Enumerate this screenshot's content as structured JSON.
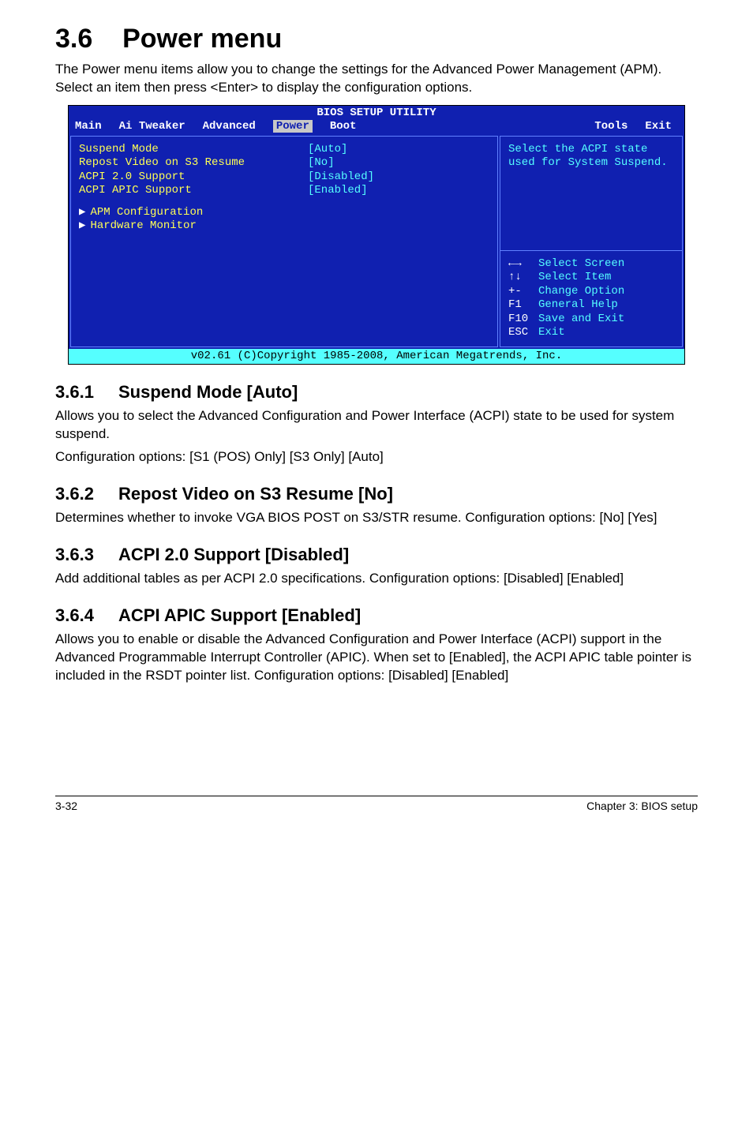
{
  "title": {
    "num": "3.6",
    "text": "Power menu"
  },
  "intro": "The Power menu items allow you to change the settings for the Advanced Power Management (APM). Select an item then press <Enter> to display the configuration options.",
  "bios": {
    "header": "BIOS SETUP UTILITY",
    "menus": [
      "Main",
      "Ai Tweaker",
      "Advanced",
      "Power",
      "Boot",
      "Tools",
      "Exit"
    ],
    "activeMenu": "Power",
    "rows": [
      {
        "label": "Suspend Mode",
        "value": "[Auto]"
      },
      {
        "label": "Repost Video on S3 Resume",
        "value": "[No]"
      },
      {
        "label": "ACPI 2.0 Support",
        "value": "[Disabled]"
      },
      {
        "label": "ACPI APIC Support",
        "value": "[Enabled]"
      }
    ],
    "submenus": [
      "APM Configuration",
      "Hardware Monitor"
    ],
    "help": "Select the ACPI state used for System Suspend.",
    "keys": [
      {
        "k": "←→",
        "d": "Select Screen"
      },
      {
        "k": "↑↓",
        "d": "Select Item"
      },
      {
        "k": "+-",
        "d": "Change Option"
      },
      {
        "k": "F1",
        "d": "General Help"
      },
      {
        "k": "F10",
        "d": "Save and Exit"
      },
      {
        "k": "ESC",
        "d": "Exit"
      }
    ],
    "footer": "v02.61 (C)Copyright 1985-2008, American Megatrends, Inc."
  },
  "sections": [
    {
      "num": "3.6.1",
      "title": "Suspend Mode [Auto]",
      "body": [
        "Allows you to select the Advanced Configuration and Power Interface (ACPI) state to be used for system suspend.",
        "Configuration options: [S1 (POS) Only] [S3 Only] [Auto]"
      ]
    },
    {
      "num": "3.6.2",
      "title": "Repost Video on S3 Resume [No]",
      "body": [
        "Determines whether to invoke VGA BIOS POST on S3/STR resume. Configuration options: [No] [Yes]"
      ]
    },
    {
      "num": "3.6.3",
      "title": "ACPI 2.0 Support [Disabled]",
      "body": [
        "Add additional tables as per ACPI 2.0 specifications. Configuration options: [Disabled] [Enabled]"
      ]
    },
    {
      "num": "3.6.4",
      "title": "ACPI APIC Support [Enabled]",
      "body": [
        "Allows you to enable or disable the Advanced Configuration and Power Interface (ACPI) support in the Advanced Programmable Interrupt Controller (APIC). When set to [Enabled], the ACPI APIC table pointer is included in the RSDT pointer list. Configuration options: [Disabled] [Enabled]"
      ]
    }
  ],
  "footer": {
    "left": "3-32",
    "right": "Chapter 3: BIOS setup"
  }
}
